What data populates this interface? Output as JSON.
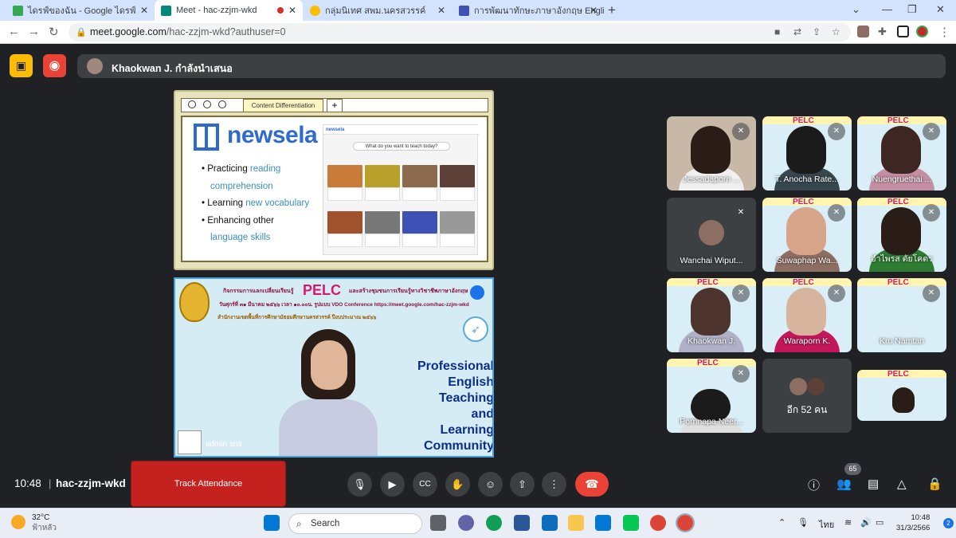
{
  "browser": {
    "tabs": [
      {
        "title": "ไดรฟ์ของฉัน - Google ไดรฟ์",
        "favicon": "drive-icon",
        "active": false
      },
      {
        "title": "Meet - hac-zzjm-wkd",
        "favicon": "meet-icon",
        "active": true
      },
      {
        "title": "กลุ่มนิเทศ สพม.นครสวรรค์",
        "favicon": "group-icon",
        "active": false
      },
      {
        "title": "การพัฒนาทักษะภาษาอังกฤษ English",
        "favicon": "forms-icon",
        "active": false
      }
    ],
    "url_host": "meet.google.com",
    "url_path": "/hac-zzjm-wkd?authuser=0"
  },
  "meet": {
    "presenter_text": "Khaokwan J. กำลังนำเสนอ",
    "slide1": {
      "tab_label": "Content Differentiation",
      "brand": "newsela",
      "bullets": [
        {
          "plain": "Practicing ",
          "highlight": "reading"
        },
        {
          "plain": "",
          "highlight": "comprehension"
        },
        {
          "plain": "Learning ",
          "highlight": "new vocabulary"
        },
        {
          "plain": "Enhancing other",
          "highlight": ""
        },
        {
          "plain": "",
          "highlight": "language skills"
        }
      ],
      "screenshot_logo": "newsela",
      "screenshot_query": "What do you want to teach today?"
    },
    "slide2": {
      "line1": "กิจกรรมการแลกเปลี่ยนเรียนรู้",
      "pelc": "PELC",
      "line1b": "และสร้างชุมชนการเรียนรู้ทางวิชาชีพภาษาอังกฤษ",
      "line2": "วันศุกร์ที่ ๓๑ มีนาคม ๒๕๖๖ เวลา ๑๐.๐๐น. รูปแบบ VDO Conference https://meet.google.com/hac-zzjm-wkd",
      "line3": "สำนักงานเขตพื้นที่การศึกษามัธยมศึกษานครสวรรค์ ปีงบประมาณ ๒๕๖๖",
      "pet_lines": [
        "Professional",
        "English",
        "Teaching",
        "and",
        "Learning",
        "Community"
      ],
      "admin_name": "admin sns"
    },
    "participants": [
      {
        "name": "Jessadaporn ...",
        "muted": true,
        "bg": "video"
      },
      {
        "name": "T. Anocha Rate...",
        "muted": true,
        "bg": "slide"
      },
      {
        "name": "Nuengruethai ...",
        "muted": true,
        "bg": "slide"
      },
      {
        "name": "Wanchai Wiput...",
        "muted": true,
        "bg": "avatar"
      },
      {
        "name": "Suwaphap Wa...",
        "muted": true,
        "bg": "slide"
      },
      {
        "name": "อำไพรส ตัยโคตร",
        "muted": true,
        "bg": "slide"
      },
      {
        "name": "Khaokwan J.",
        "muted": true,
        "bg": "slide"
      },
      {
        "name": "Waraporn K.",
        "muted": true,
        "bg": "slide"
      },
      {
        "name": "Kru Namtan",
        "muted": true,
        "bg": "slide"
      },
      {
        "name": "Pornnapa Neer...",
        "muted": true,
        "bg": "slide"
      },
      {
        "name": "อีก 52 คน",
        "muted": false,
        "bg": "more"
      },
      {
        "name": "",
        "muted": false,
        "bg": "slide"
      }
    ],
    "bottom": {
      "time": "10:48",
      "meeting_code": "hac-zzjm-wkd",
      "track_attendance": "Track Attendance",
      "people_count": "65"
    }
  },
  "taskbar": {
    "temperature": "32°C",
    "weather": "ฟ้าหลัว",
    "search_label": "Search",
    "lang": "ไทย",
    "time": "10:48",
    "date": "31/3/2566",
    "notifications": "2"
  },
  "colors": {
    "meet_bg": "#202124",
    "end_call": "#ea4335",
    "track_attendance": "#c5221f",
    "newsela_blue": "#2d6bcf"
  }
}
